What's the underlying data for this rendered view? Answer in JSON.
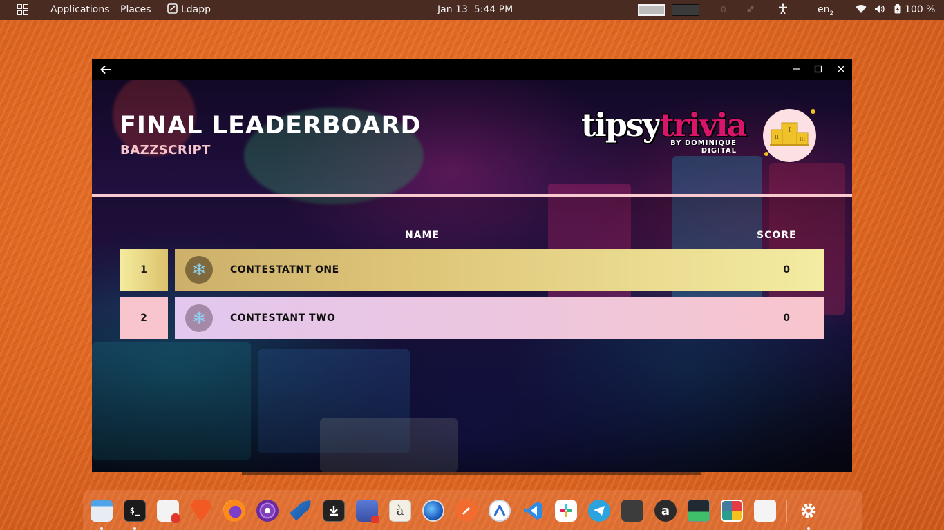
{
  "panel": {
    "applications": "Applications",
    "places": "Places",
    "active_app": "Ldapp",
    "date": "Jan 13",
    "time": "5:44 PM",
    "notification_count": "0",
    "keyboard_layout": "en",
    "keyboard_layout_sub": "2",
    "battery": "100 %"
  },
  "window": {
    "title": "FINAL LEADERBOARD",
    "subtitle": "BAZZSCRIPT",
    "logo_word_1": "tipsy",
    "logo_word_2": "trivia",
    "logo_by": "BY DOMINIQUE",
    "logo_company": "DIGITAL",
    "columns": {
      "name": "NAME",
      "score": "SCORE"
    },
    "rows": [
      {
        "rank": "1",
        "name": "CONTESTATNT ONE",
        "score": "0",
        "avatar_icon": "snowflake-icon"
      },
      {
        "rank": "2",
        "name": "CONTESTANT TWO",
        "score": "0",
        "avatar_icon": "snowflake-icon"
      }
    ]
  },
  "colors": {
    "row1": "#e8d37e",
    "row2": "#f1c3d6",
    "accent_pink": "#f8c9cf",
    "logo_pink": "#d9146d",
    "gold": "#f4c21f"
  },
  "dock": {
    "apps": [
      {
        "name": "files-icon"
      },
      {
        "name": "terminal-icon",
        "glyph": "$_"
      },
      {
        "name": "text-editor-icon"
      },
      {
        "name": "brave-browser-icon"
      },
      {
        "name": "firefox-icon"
      },
      {
        "name": "tor-browser-icon"
      },
      {
        "name": "bird-app-icon"
      },
      {
        "name": "downloader-icon"
      },
      {
        "name": "screen-recorder-icon"
      },
      {
        "name": "character-map-icon",
        "glyph": "à"
      },
      {
        "name": "browser-globe-icon"
      },
      {
        "name": "pencil-app-icon"
      },
      {
        "name": "appimage-icon"
      },
      {
        "name": "vscode-icon"
      },
      {
        "name": "slack-icon"
      },
      {
        "name": "telegram-icon"
      },
      {
        "name": "calculator-icon"
      },
      {
        "name": "amazon-icon",
        "glyph": "a"
      },
      {
        "name": "system-monitor-icon"
      },
      {
        "name": "color-picker-icon"
      },
      {
        "name": "emoji-app-icon"
      },
      {
        "name": "settings-icon"
      },
      {
        "name": "app-grid-icon"
      }
    ]
  }
}
